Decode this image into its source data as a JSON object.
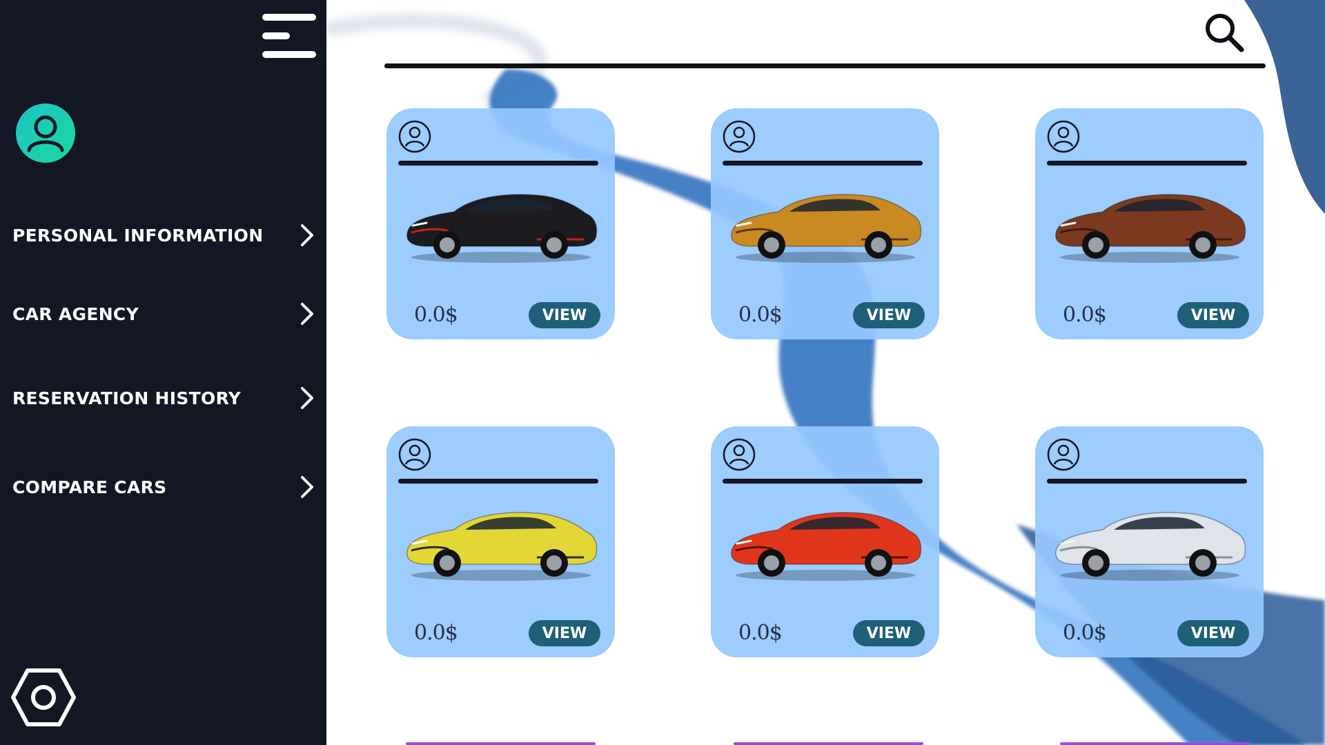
{
  "sidebar": {
    "menu_icon": "hamburger-menu-icon",
    "avatar_icon": "user-avatar-icon",
    "settings_icon": "settings-hexagon-icon",
    "accent_gradient": [
      "#1fc4c8",
      "#1ad8a0"
    ],
    "background_color": "#121723",
    "nav": [
      {
        "label": "PERSONAL INFORMATION",
        "icon": "chevron-right-icon"
      },
      {
        "label": "CAR AGENCY",
        "icon": "chevron-right-icon"
      },
      {
        "label": "RESERVATION HISTORY",
        "icon": "chevron-right-icon"
      },
      {
        "label": "COMPARE CARS",
        "icon": "chevron-right-icon"
      }
    ]
  },
  "header": {
    "search_icon": "search-icon"
  },
  "colors": {
    "card": "#96c8ff",
    "button": "#1e6077",
    "deco_wave": "#2f6fbe"
  },
  "cars": [
    {
      "price": "0.0$",
      "view_label": "VIEW",
      "car_color": "#1c1c20",
      "accent": "#c81e23"
    },
    {
      "price": "0.0$",
      "view_label": "VIEW",
      "car_color": "#c98a22",
      "accent": "#5a3a10"
    },
    {
      "price": "0.0$",
      "view_label": "VIEW",
      "car_color": "#7b3a1f",
      "accent": "#3d1c0e"
    },
    {
      "price": "0.0$",
      "view_label": "VIEW",
      "car_color": "#e3d737",
      "accent": "#2a2a2a"
    },
    {
      "price": "0.0$",
      "view_label": "VIEW",
      "car_color": "#e0371c",
      "accent": "#5a1008"
    },
    {
      "price": "0.0$",
      "view_label": "VIEW",
      "car_color": "#dfe3ea",
      "accent": "#8a8f98"
    }
  ]
}
